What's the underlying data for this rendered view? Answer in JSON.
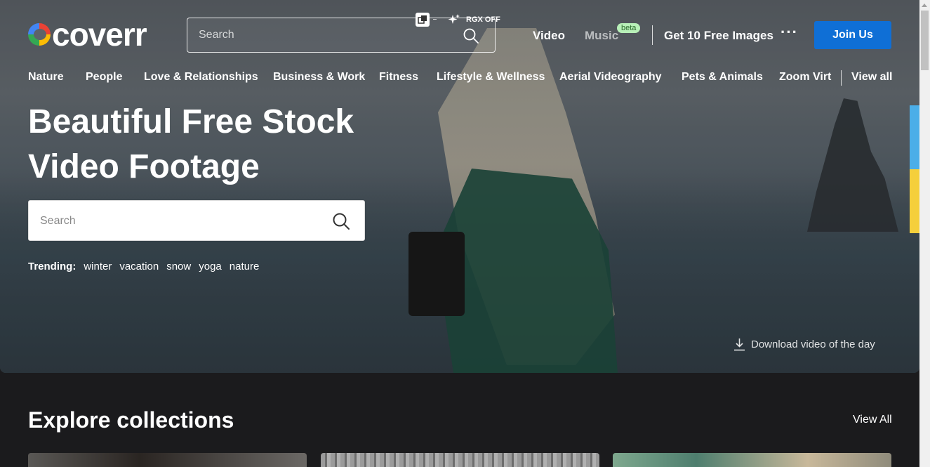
{
  "header": {
    "logo_text": "coverr",
    "search_placeholder": "Search",
    "extension_label": "RGX OFF",
    "nav": {
      "video": "Video",
      "music": "Music",
      "music_badge": "beta",
      "free_images": "Get 10 Free Images",
      "more": "···",
      "join": "Join Us"
    }
  },
  "categories": [
    "Nature",
    "People",
    "Love & Relationships",
    "Business & Work",
    "Fitness",
    "Lifestyle & Wellness",
    "Aerial Videography",
    "Pets & Animals",
    "Zoom Virt"
  ],
  "categories_view_all": "View all",
  "hero": {
    "title_line1": "Beautiful Free Stock",
    "title_line2": "Video Footage",
    "search_placeholder": "Search",
    "trending_label": "Trending:",
    "trending_tags": [
      "winter",
      "vacation",
      "snow",
      "yoga",
      "nature"
    ],
    "download_label": "Download video of the day"
  },
  "collections": {
    "title": "Explore collections",
    "view_all": "View All"
  },
  "icons": {
    "search": "search-icon",
    "download": "download-icon",
    "sparkle": "sparkle-icon",
    "extension": "extension-icon"
  },
  "colors": {
    "join_button": "#0f6fd6",
    "beta_badge": "#b8f0b8",
    "page_bg": "#1b1b1d"
  }
}
